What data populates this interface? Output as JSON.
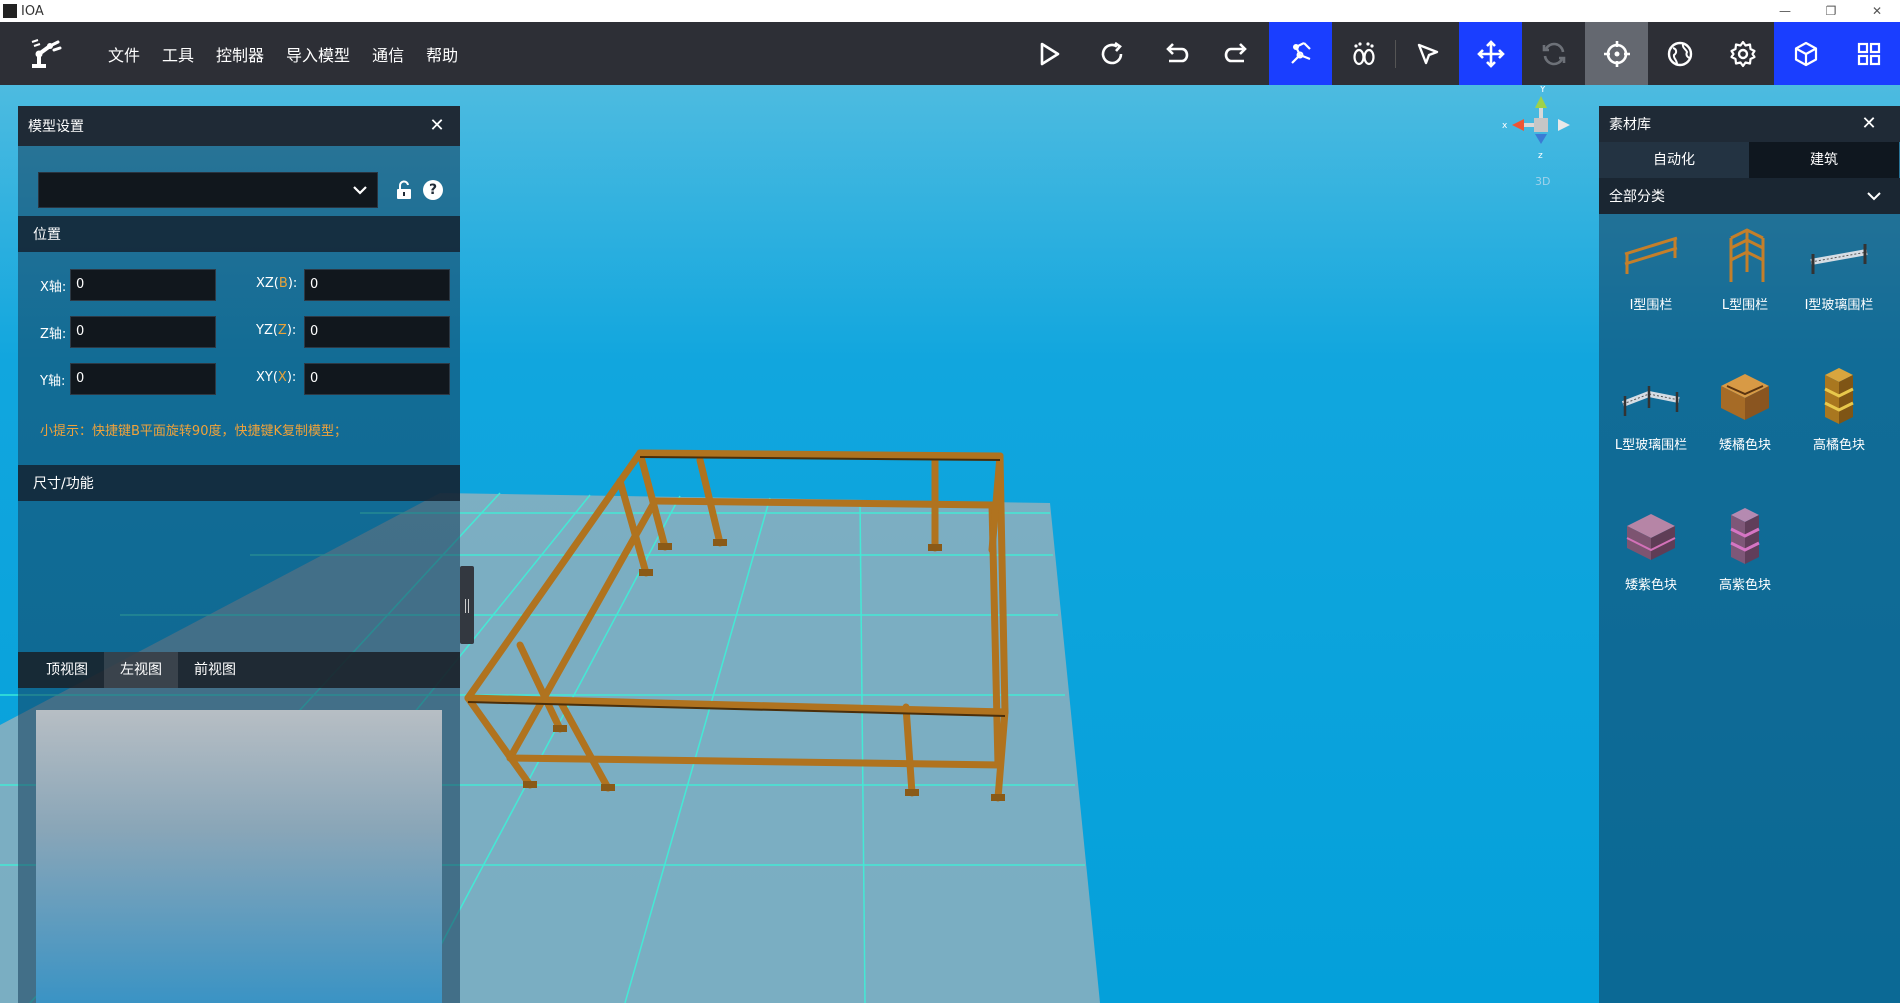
{
  "window": {
    "title": "IOA",
    "buttons": [
      "minimize-icon",
      "restore-icon",
      "close-icon"
    ]
  },
  "menu": [
    "文件",
    "工具",
    "控制器",
    "导入模型",
    "通信",
    "帮助"
  ],
  "toolbar": {
    "tools": [
      {
        "name": "play-icon",
        "state": "normal"
      },
      {
        "name": "refresh-icon",
        "state": "normal"
      },
      {
        "name": "undo-icon",
        "state": "normal"
      },
      {
        "name": "redo-icon",
        "state": "normal"
      },
      {
        "name": "robot-arm-icon",
        "state": "active"
      },
      {
        "name": "footprint-icon",
        "state": "normal"
      },
      {
        "name": "select-pointer-icon",
        "state": "normal"
      },
      {
        "name": "move-icon",
        "state": "active"
      },
      {
        "name": "rotate-icon",
        "state": "disabled"
      },
      {
        "name": "crosshair-icon",
        "state": "selected"
      },
      {
        "name": "globe-icon",
        "state": "normal"
      },
      {
        "name": "settings-icon",
        "state": "normal"
      },
      {
        "name": "cube-icon",
        "state": "active"
      },
      {
        "name": "grid-icon",
        "state": "active"
      }
    ],
    "accent": "#1a3eff"
  },
  "model_panel": {
    "title": "模型设置",
    "select_value": "",
    "position_header": "位置",
    "fields": {
      "x_axis": {
        "label": "X轴:",
        "value": "0"
      },
      "z_axis": {
        "label": "Z轴:",
        "value": "0"
      },
      "y_axis": {
        "label": "Y轴:",
        "value": "0"
      },
      "xz": {
        "prefix": "XZ(",
        "letter": "B",
        "suffix": "):",
        "value": "0"
      },
      "yz": {
        "prefix": "YZ(",
        "letter": "Z",
        "suffix": "):",
        "value": "0"
      },
      "xy": {
        "prefix": "XY(",
        "letter": "X",
        "suffix": "):",
        "value": "0"
      }
    },
    "tip": "小提示：快捷键B平面旋转90度，快捷键K复制模型；",
    "size_header": "尺寸/功能",
    "view_tabs": [
      "顶视图",
      "左视图",
      "前视图"
    ],
    "active_view": 1
  },
  "gizmo": {
    "label": "3D",
    "x": "x",
    "y": "Y",
    "z": "z"
  },
  "library": {
    "title": "素材库",
    "tabs": [
      "自动化",
      "建筑"
    ],
    "active_tab": 1,
    "category": "全部分类",
    "items": [
      {
        "label": "I型围栏",
        "icon": "i-fence-icon"
      },
      {
        "label": "L型围栏",
        "icon": "l-fence-icon"
      },
      {
        "label": "I型玻璃围栏",
        "icon": "i-glass-fence-icon"
      },
      {
        "label": "L型玻璃围栏",
        "icon": "l-glass-fence-icon"
      },
      {
        "label": "矮橘色块",
        "icon": "short-orange-block-icon"
      },
      {
        "label": "高橘色块",
        "icon": "tall-orange-block-icon"
      },
      {
        "label": "矮紫色块",
        "icon": "short-purple-block-icon"
      },
      {
        "label": "高紫色块",
        "icon": "tall-purple-block-icon"
      }
    ]
  }
}
